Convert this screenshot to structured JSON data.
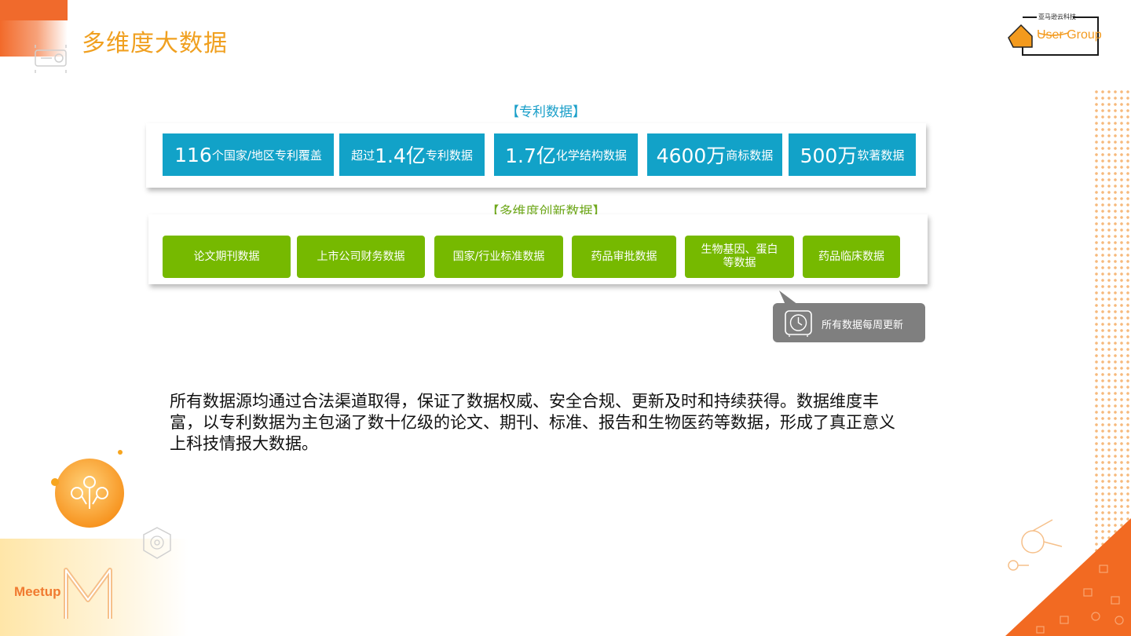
{
  "slide": {
    "title": "多维度大数据"
  },
  "logo": {
    "small_text": "亚马逊云科技",
    "group_text": "User Group"
  },
  "patent_section": {
    "header": "【专利数据】",
    "items": [
      {
        "big": "116",
        "small": "个国家/地区专利覆盖"
      },
      {
        "pre": "超过",
        "big": "1.4亿",
        "small": "专利数据"
      },
      {
        "big": "1.7亿",
        "small": "化学结构数据"
      },
      {
        "big": "4600万",
        "small": "商标数据"
      },
      {
        "big": "500万",
        "small": "软著数据"
      }
    ]
  },
  "innovation_section": {
    "header": "【多维度创新数据】",
    "items": [
      "论文期刊数据",
      "上市公司财务数据",
      "国家/行业标准数据",
      "药品审批数据",
      "生物基因、蛋白等数据",
      "药品临床数据"
    ]
  },
  "callout": {
    "text": "所有数据每周更新",
    "icon": "clock-icon"
  },
  "paragraph": "所有数据源均通过合法渠道取得，保证了数据权威、安全合规、更新及时和持续获得。数据维度丰富，以专利数据为主包涵了数十亿级的论文、期刊、标准、报告和生物医药等数据，形成了真正意义上科技情报大数据。",
  "footer": {
    "meetup": "Meetup"
  },
  "colors": {
    "accent_orange": "#f06a2c",
    "title_color": "#f0a020",
    "patent_blue": "#12a2c8",
    "innovation_green": "#76b900",
    "callout_gray": "#7f7f7f"
  }
}
